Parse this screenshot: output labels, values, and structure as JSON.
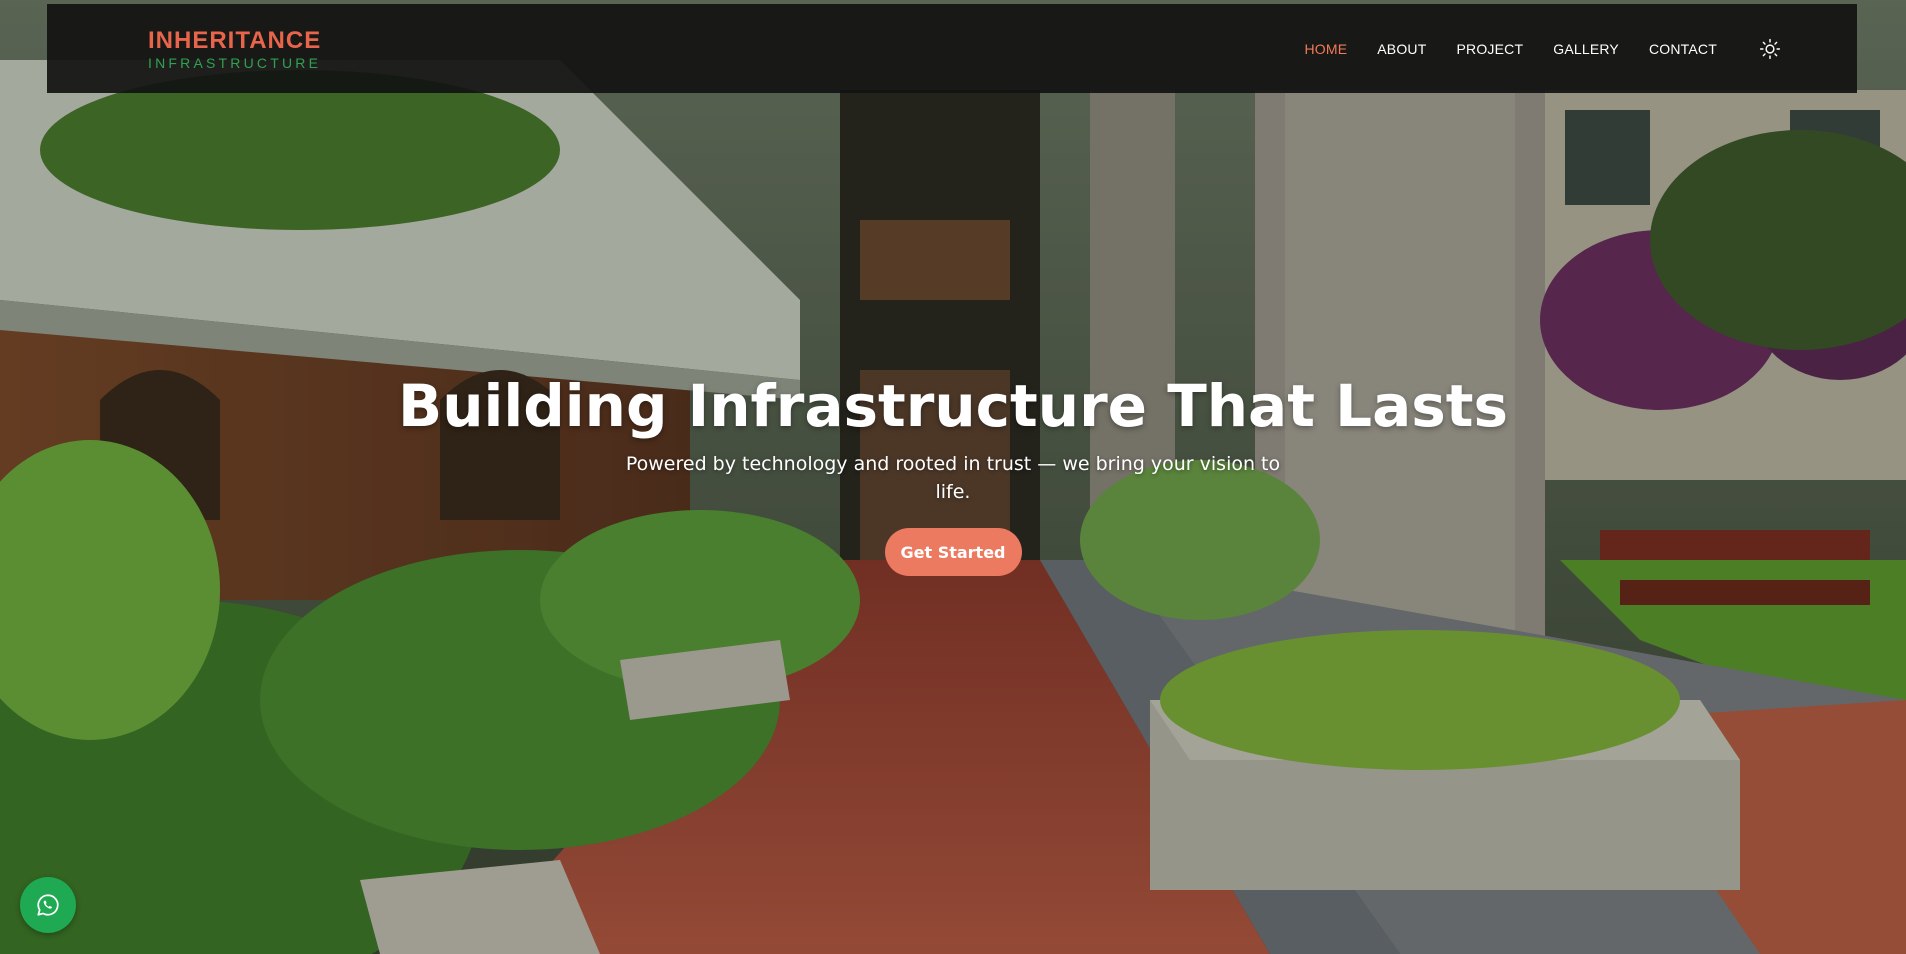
{
  "logo": {
    "line1": "INHERITANCE",
    "line2": "INFRASTRUCTURE"
  },
  "nav": {
    "items": [
      {
        "label": "HOME",
        "active": true
      },
      {
        "label": "ABOUT",
        "active": false
      },
      {
        "label": "PROJECT",
        "active": false
      },
      {
        "label": "GALLERY",
        "active": false
      },
      {
        "label": "CONTACT",
        "active": false
      }
    ],
    "theme_toggle_icon": "sun-icon"
  },
  "hero": {
    "title": "Building Infrastructure That Lasts",
    "subtitle": "Powered by technology and rooted in trust — we bring your vision to life.",
    "cta_label": "Get Started"
  },
  "floating": {
    "whatsapp_icon": "whatsapp-icon"
  },
  "colors": {
    "accent": "#ec7a60",
    "logo_orange": "#e8644a",
    "logo_green": "#2fa24f",
    "whatsapp": "#1ea952",
    "navbar": "#121212"
  }
}
